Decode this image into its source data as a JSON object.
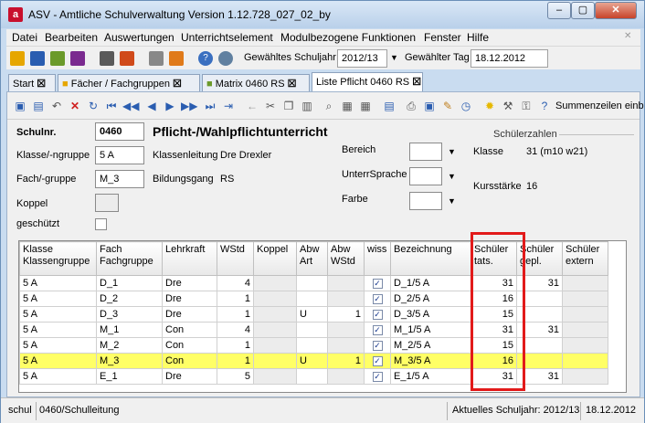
{
  "window": {
    "title": "ASV - Amtliche Schulverwaltung Version 1.12.728_027_02_by",
    "app_icon": "a",
    "controls": [
      "–",
      "▢",
      "✕"
    ]
  },
  "menu": [
    "Datei",
    "Bearbeiten",
    "Auswertungen",
    "Unterrichtselement",
    "Modulbezogene Funktionen",
    "Fenster",
    "Hilfe"
  ],
  "toolbar": {
    "school_year_label": "Gewähltes Schuljahr",
    "school_year_value": "2012/13",
    "day_label": "Gewählter Tag",
    "day_value": "18.12.2012"
  },
  "tabs": [
    {
      "label": "Start"
    },
    {
      "label": "Fächer / Fachgruppen"
    },
    {
      "label": "Matrix 0460 RS"
    },
    {
      "label": "Liste Pflicht 0460 RS"
    }
  ],
  "action_toolbar": {
    "summary_label": "Summenzeilen einb"
  },
  "form": {
    "schulnr_label": "Schulnr.",
    "schulnr_value": "0460",
    "heading": "Pflicht-/Wahlpflichtunterricht",
    "klasse_label": "Klasse/-ngruppe",
    "klasse_value": "5 A",
    "fach_label": "Fach/-gruppe",
    "fach_value": "M_3",
    "koppel_label": "Koppel",
    "geschuetzt_label": "geschützt",
    "klassenleitung_label": "Klassenleitung",
    "klassenleitung_value": "Dre Drexler",
    "bildungsgang_label": "Bildungsgang",
    "bildungsgang_value": "RS",
    "bereich_label": "Bereich",
    "unterrsprache_label": "UnterrSprache",
    "farbe_label": "Farbe",
    "schuelerzahlen_label": "Schülerzahlen",
    "klasse2_label": "Klasse",
    "klasse2_value": "31 (m10 w21)",
    "kursstaerke_label": "Kursstärke",
    "kursstaerke_value": "16"
  },
  "table": {
    "headers": [
      [
        "Klasse",
        "Klassengruppe"
      ],
      [
        "Fach",
        "Fachgruppe"
      ],
      [
        "Lehrkraft",
        ""
      ],
      [
        "WStd",
        ""
      ],
      [
        "Koppel",
        ""
      ],
      [
        "Abw",
        "Art"
      ],
      [
        "Abw",
        "WStd"
      ],
      [
        "wiss",
        ""
      ],
      [
        "Bezeichnung",
        ""
      ],
      [
        "Schüler",
        "tats."
      ],
      [
        "Schüler",
        "gepl."
      ],
      [
        "Schüler",
        "extern"
      ]
    ],
    "rows": [
      {
        "klasse": "5 A",
        "fach": "D_1",
        "lehrkraft": "Dre",
        "wstd": "4",
        "koppel": "",
        "abw_art": "",
        "abw_wstd": "",
        "wiss": true,
        "bez": "D_1/5 A",
        "tats": "31",
        "gepl": "31",
        "extern": "",
        "selected": false
      },
      {
        "klasse": "5 A",
        "fach": "D_2",
        "lehrkraft": "Dre",
        "wstd": "1",
        "koppel": "",
        "abw_art": "",
        "abw_wstd": "",
        "wiss": true,
        "bez": "D_2/5 A",
        "tats": "16",
        "gepl": "",
        "extern": "",
        "selected": false
      },
      {
        "klasse": "5 A",
        "fach": "D_3",
        "lehrkraft": "Dre",
        "wstd": "1",
        "koppel": "",
        "abw_art": "U",
        "abw_wstd": "1",
        "wiss": true,
        "bez": "D_3/5 A",
        "tats": "15",
        "gepl": "",
        "extern": "",
        "selected": false
      },
      {
        "klasse": "5 A",
        "fach": "M_1",
        "lehrkraft": "Con",
        "wstd": "4",
        "koppel": "",
        "abw_art": "",
        "abw_wstd": "",
        "wiss": true,
        "bez": "M_1/5 A",
        "tats": "31",
        "gepl": "31",
        "extern": "",
        "selected": false
      },
      {
        "klasse": "5 A",
        "fach": "M_2",
        "lehrkraft": "Con",
        "wstd": "1",
        "koppel": "",
        "abw_art": "",
        "abw_wstd": "",
        "wiss": true,
        "bez": "M_2/5 A",
        "tats": "15",
        "gepl": "",
        "extern": "",
        "selected": false
      },
      {
        "klasse": "5 A",
        "fach": "M_3",
        "lehrkraft": "Con",
        "wstd": "1",
        "koppel": "",
        "abw_art": "U",
        "abw_wstd": "1",
        "wiss": true,
        "bez": "M_3/5 A",
        "tats": "16",
        "gepl": "",
        "extern": "",
        "selected": true
      },
      {
        "klasse": "5 A",
        "fach": "E_1",
        "lehrkraft": "Dre",
        "wstd": "5",
        "koppel": "",
        "abw_art": "",
        "abw_wstd": "",
        "wiss": true,
        "bez": "E_1/5 A",
        "tats": "31",
        "gepl": "31",
        "extern": "",
        "selected": false
      }
    ]
  },
  "status": {
    "left": "schul",
    "middle": "0460/Schulleitung",
    "year": "Aktuelles Schuljahr: 2012/13",
    "date": "18.12.2012"
  },
  "colors": {
    "highlight": "#ffff66",
    "annotation": "#e21a1a",
    "brand": "#c8102e"
  }
}
